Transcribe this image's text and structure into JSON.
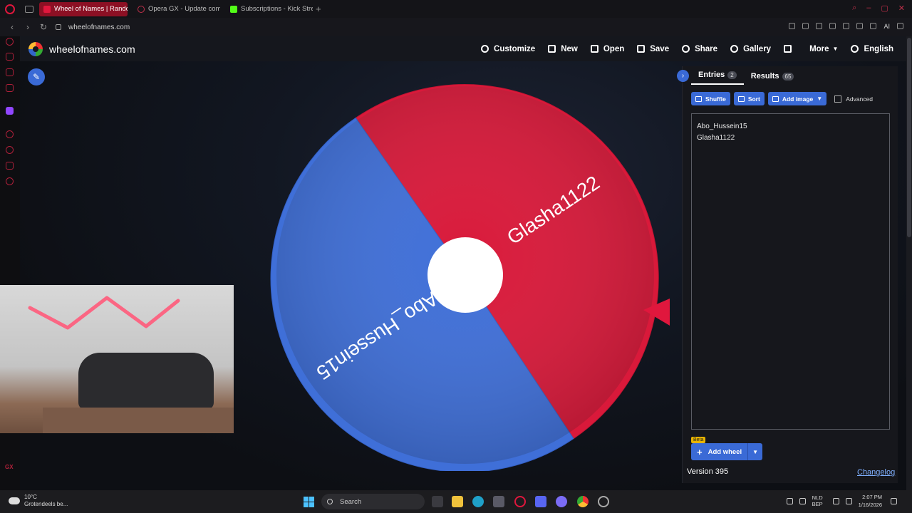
{
  "browser": {
    "tabs": [
      {
        "label": "Wheel of Names | Random",
        "active": true,
        "color": "#e0173d"
      },
      {
        "label": "Opera GX - Update comp",
        "active": false,
        "color": "#c0304a"
      },
      {
        "label": "Subscriptions - Kick Strea",
        "active": false,
        "color": "#53fc18"
      }
    ],
    "url": "wheelofnames.com",
    "ai_label": "AI"
  },
  "site": {
    "name": "wheelofnames.com",
    "menu": [
      {
        "label": "Customize",
        "icon": "palette-icon"
      },
      {
        "label": "New",
        "icon": "new-file-icon"
      },
      {
        "label": "Open",
        "icon": "folder-icon"
      },
      {
        "label": "Save",
        "icon": "save-icon"
      },
      {
        "label": "Share",
        "icon": "share-icon"
      },
      {
        "label": "Gallery",
        "icon": "search-icon"
      },
      {
        "label": "",
        "icon": "fullscreen-icon"
      },
      {
        "label": "More",
        "icon": "",
        "caret": true
      },
      {
        "label": "English",
        "icon": "globe-icon"
      }
    ]
  },
  "wheel": {
    "segments": [
      {
        "label": "Glasha1122",
        "color": "#d9193a"
      },
      {
        "label": "Abo_Hussein15",
        "color": "#3f6fd8"
      }
    ],
    "pointer_color": "#e0173d"
  },
  "panel": {
    "tabs": [
      {
        "label": "Entries",
        "count": "2"
      },
      {
        "label": "Results",
        "count": "65"
      }
    ],
    "toolbar": {
      "shuffle": "Shuffle",
      "sort": "Sort",
      "add_image": "Add image",
      "advanced": "Advanced"
    },
    "entries": [
      "Abo_Hussein15",
      "Glasha1122"
    ],
    "add_wheel": "Add wheel",
    "beta": "Beta",
    "version": "Version 395",
    "changelog": "Changelog"
  },
  "taskbar": {
    "weather_temp": "10°C",
    "weather_desc": "Grotendeels be...",
    "search": "Search",
    "lang_1": "NLD",
    "lang_2": "BEP",
    "time": "2:07 PM",
    "date": "1/16/2026"
  }
}
